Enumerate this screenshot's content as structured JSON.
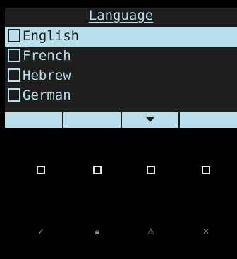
{
  "title": "Language",
  "languages": [
    {
      "label": "English",
      "selected": true
    },
    {
      "label": "French",
      "selected": false
    },
    {
      "label": "Hebrew",
      "selected": false
    },
    {
      "label": "German",
      "selected": false
    }
  ],
  "softkeys": [
    "",
    "",
    "down-arrow-icon",
    ""
  ],
  "keypad": {
    "top_row_icons": [
      "square-icon",
      "square-icon",
      "square-icon",
      "square-icon"
    ],
    "bottom_row": [
      {
        "icon": "check-icon",
        "glyph": "✓"
      },
      {
        "icon": "lock-icon",
        "glyph": "🔒︎"
      },
      {
        "icon": "warning-icon",
        "glyph": "⚠"
      },
      {
        "icon": "close-icon",
        "glyph": "✕"
      }
    ]
  },
  "colors": {
    "lcd_background": "#1e1e1e",
    "lcd_text": "#b8dfec",
    "device_background": "#000000"
  }
}
